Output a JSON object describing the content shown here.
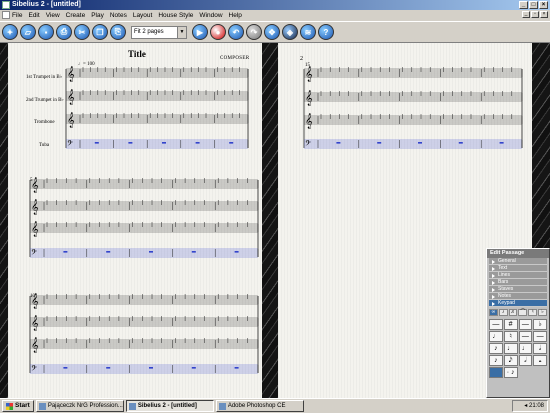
{
  "window": {
    "title": "Sibelius 2 - [untitled]"
  },
  "menu": [
    "File",
    "Edit",
    "View",
    "Create",
    "Play",
    "Notes",
    "Layout",
    "House Style",
    "Window",
    "Help"
  ],
  "toolbar": {
    "zoom_value": "Fit 2 pages"
  },
  "score": {
    "title": "Title",
    "composer": "COMPOSER",
    "tempo": "♩= 100",
    "instruments": [
      "1st Trumpet in B♭",
      "2nd Trumpet in B♭",
      "Trombone",
      "Tuba"
    ],
    "page2_number": "2",
    "system_bar_numbers": [
      "5",
      "10",
      "15"
    ]
  },
  "panel": {
    "title": "Edit Passage",
    "sections": [
      "General",
      "Text",
      "Lines",
      "Bars",
      "Staves",
      "Notes",
      "Keypad"
    ],
    "selected_section": "Keypad",
    "keypad": [
      "—",
      "#",
      "—",
      "♭",
      "♩",
      "♮",
      "—",
      "—",
      "♪",
      "♩",
      "♩",
      "𝅗𝅥",
      "♪",
      "𝅘𝅥𝅯",
      "𝅗𝅥",
      "𝅝",
      " ",
      "· ♪"
    ]
  },
  "taskbar": {
    "start": "Start",
    "tasks": [
      "Pająceczk NrG Profession...",
      "Sibelius 2 - [untitled]",
      "Adobe Photoshop CE"
    ],
    "active_task": "Sibelius 2 - [untitled]",
    "clock": "21:08"
  },
  "colors": {
    "titlebar_start": "#0a246a",
    "titlebar_end": "#a6caf0",
    "panel_selected": "#3a6ea5",
    "tuba_staff": "#3344cc"
  }
}
